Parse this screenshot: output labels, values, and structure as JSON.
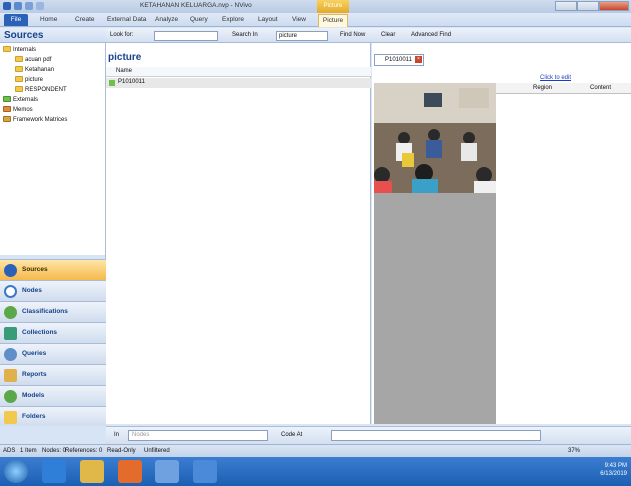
{
  "window": {
    "title": "KETAHANAN KELUARGA.nvp - NVivo",
    "context_tab": "Picture Tools"
  },
  "ribbon": {
    "tabs": [
      "File",
      "Home",
      "Create",
      "External Data",
      "Analyze",
      "Query",
      "Explore",
      "Layout",
      "View",
      "Picture"
    ]
  },
  "sources_panel": {
    "title": "Sources",
    "tree": [
      {
        "label": "Internals",
        "children": [
          "acuan pdf",
          "Ketahanan",
          "picture",
          "RESPONDENT"
        ]
      },
      {
        "label": "Externals"
      },
      {
        "label": "Memos"
      },
      {
        "label": "Framework Matrices"
      }
    ]
  },
  "navigation": {
    "items": [
      "Sources",
      "Nodes",
      "Classifications",
      "Collections",
      "Queries",
      "Reports",
      "Models",
      "Folders"
    ],
    "active": "Sources"
  },
  "find_bar": {
    "look_for_label": "Look for:",
    "look_for_value": "",
    "search_in_label": "Search In",
    "search_in_value": "picture",
    "find_now": "Find Now",
    "clear": "Clear",
    "advanced_find": "Advanced Find"
  },
  "list": {
    "title": "picture",
    "column_name": "Name",
    "rows": [
      "P1010011"
    ]
  },
  "document": {
    "tab_label": "P1010011",
    "click_to_edit": "Click to edit",
    "columns": [
      "Region",
      "Content"
    ]
  },
  "code_bar": {
    "in_label": "In",
    "in_value": "Nodes",
    "code_at": "Code At"
  },
  "status_bar": {
    "user": "ADS",
    "items": "1 Item",
    "nodes": "Nodes: 0",
    "references": "References: 0",
    "read_only": "Read-Only",
    "unfiltered": "Unfiltered",
    "zoom": "37%"
  },
  "taskbar": {
    "time": "9:43 PM",
    "date": "6/13/2019"
  }
}
